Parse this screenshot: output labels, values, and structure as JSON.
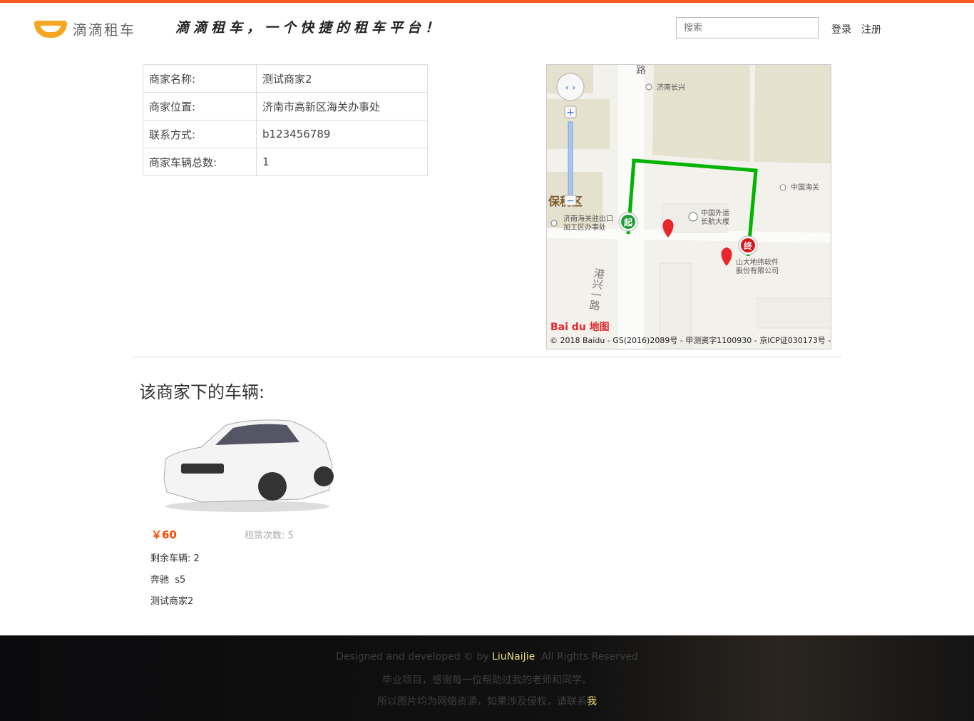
{
  "header": {
    "logo_text": "滴滴租车",
    "slogan": "滴滴租车，一个快捷的租车平台！",
    "search_placeholder": "搜索",
    "login": "登录",
    "register": "注册"
  },
  "merchant": {
    "rows": [
      {
        "label": "商家名称:",
        "value": "测试商家2"
      },
      {
        "label": "商家位置:",
        "value": "济南市高新区海关办事处"
      },
      {
        "label": "联系方式:",
        "value": "b123456789"
      },
      {
        "label": "商家车辆总数:",
        "value": "1"
      }
    ]
  },
  "map": {
    "labels": {
      "road_top": "路",
      "changxing": "济南长兴",
      "customs": "中国海关",
      "bonded": "保税区",
      "office": "济南海关驻出口加工区办事处",
      "office_l1": "济南海关驻出口",
      "office_l2": "加工区办事处",
      "building_l1": "中国外运",
      "building_l2": "长航大楼",
      "company_l1": "山大地纬软件",
      "company_l2": "股份有限公司",
      "road_vertical": "港兴一路",
      "start": "起",
      "end": "终"
    },
    "route_color": "#00b400",
    "logo": "Bai du 地图",
    "copyright": "© 2018 Baidu - GS(2016)2089号 - 甲测资字1100930 - 京ICP证030173号 -"
  },
  "section_title": "该商家下的车辆:",
  "vehicles": [
    {
      "price": "￥60",
      "rent_count": "租赁次数: 5",
      "remaining": "剩余车辆: 2",
      "model": "奔驰  s5",
      "merchant": "测试商家2"
    }
  ],
  "footer": {
    "line1_a": "Designed and developed © by ",
    "author": "LiuNaiJie",
    "line1_b": "  All Rights Reserved",
    "line2": "毕业项目，感谢每一位帮助过我的老师和同学。",
    "line3_a": "所以图片均为网络资源，如果涉及侵权，请联系",
    "contact": "我"
  },
  "colors": {
    "accent": "#ff5a1f",
    "price": "#ff4a00"
  }
}
